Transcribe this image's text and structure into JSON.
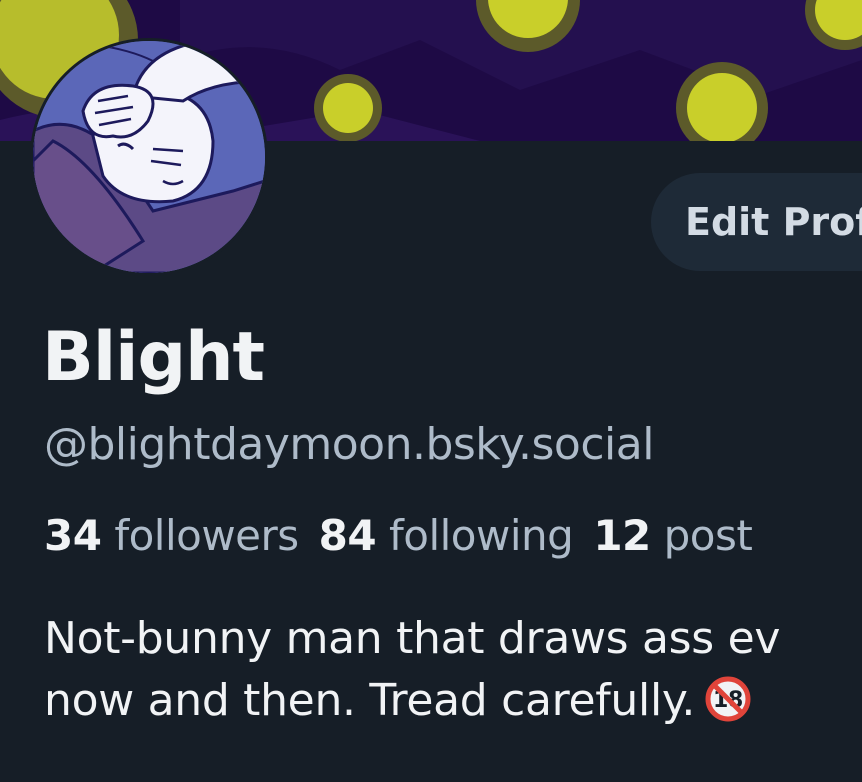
{
  "header": {
    "edit_button_label": "Edit Prof"
  },
  "profile": {
    "display_name": "Blight",
    "handle": "@blightdaymoon.bsky.social"
  },
  "stats": {
    "followers_count": "34",
    "followers_label": "followers",
    "following_count": "84",
    "following_label": "following",
    "posts_count": "12",
    "posts_label": "post"
  },
  "bio": {
    "line1": "Not-bunny man that draws ass ev",
    "line2": "now and then. Tread carefully.",
    "emoji_icon": "no-one-under-eighteen-icon"
  },
  "colors": {
    "background": "#161e27",
    "banner": "#1e0a45",
    "moon": "#c9cf2a",
    "button_bg": "#1e2a37"
  }
}
